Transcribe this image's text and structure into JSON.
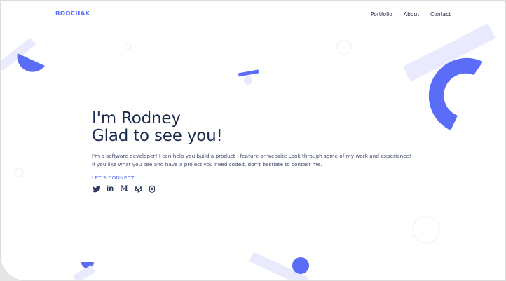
{
  "brand": {
    "logo": "RODCHAK",
    "accent_color": "#5b6df7",
    "accent_light_color": "#e9eafd",
    "text_color": "#1b2a4e"
  },
  "nav": {
    "items": [
      {
        "label": "Portfolio"
      },
      {
        "label": "About"
      },
      {
        "label": "Contact"
      }
    ]
  },
  "hero": {
    "title_line1": "I'm Rodney",
    "title_line2": "Glad to see you!",
    "description": "I'm a software developer! I can help you build a product , feature or website Look through some of my work and experience! If you like what you see and have a project you need coded, don't hestiate to contact me.",
    "connect_label": "LET'S CONNECT"
  },
  "socials": [
    {
      "icon": "twitter-icon"
    },
    {
      "icon": "linkedin-icon",
      "glyph": "in"
    },
    {
      "icon": "medium-icon",
      "glyph": "M"
    },
    {
      "icon": "gitlab-icon"
    },
    {
      "icon": "codepen-icon"
    }
  ]
}
